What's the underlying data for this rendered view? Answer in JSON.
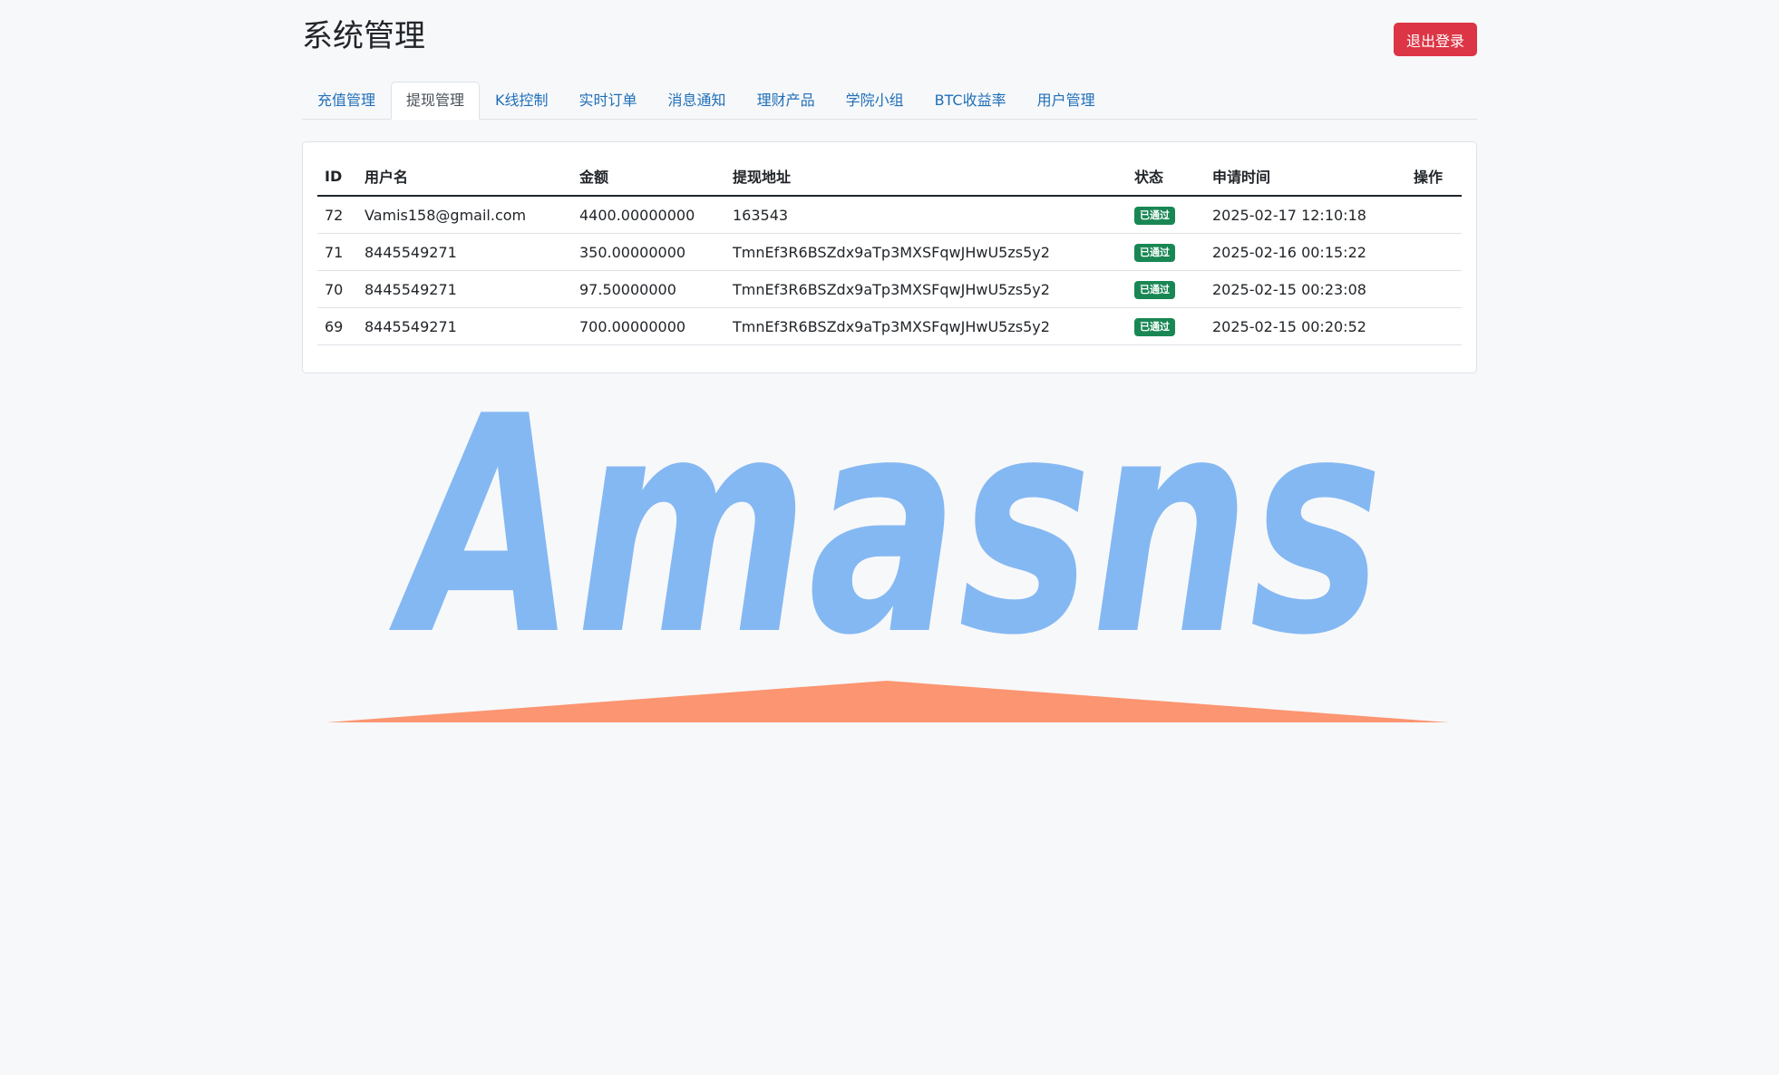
{
  "header": {
    "title": "系统管理",
    "logout_label": "退出登录"
  },
  "tabs": [
    {
      "label": "充值管理"
    },
    {
      "label": "提现管理"
    },
    {
      "label": "K线控制"
    },
    {
      "label": "实时订单"
    },
    {
      "label": "消息通知"
    },
    {
      "label": "理财产品"
    },
    {
      "label": "学院小组"
    },
    {
      "label": "BTC收益率"
    },
    {
      "label": "用户管理"
    }
  ],
  "active_tab": "提现管理",
  "table": {
    "columns": [
      "ID",
      "用户名",
      "金额",
      "提现地址",
      "状态",
      "申请时间",
      "操作"
    ],
    "rows": [
      {
        "id": "72",
        "username": "Vamis158@gmail.com",
        "amount": "4400.00000000",
        "address": "163543",
        "status": "已通过",
        "time": "2025-02-17 12:10:18",
        "action": ""
      },
      {
        "id": "71",
        "username": "8445549271",
        "amount": "350.00000000",
        "address": "TmnEf3R6BSZdx9aTp3MXSFqwJHwU5zs5y2",
        "status": "已通过",
        "time": "2025-02-16 00:15:22",
        "action": ""
      },
      {
        "id": "70",
        "username": "8445549271",
        "amount": "97.50000000",
        "address": "TmnEf3R6BSZdx9aTp3MXSFqwJHwU5zs5y2",
        "status": "已通过",
        "time": "2025-02-15 00:23:08",
        "action": ""
      },
      {
        "id": "69",
        "username": "8445549271",
        "amount": "700.00000000",
        "address": "TmnEf3R6BSZdx9aTp3MXSFqwJHwU5zs5y2",
        "status": "已通过",
        "time": "2025-02-15 00:20:52",
        "action": ""
      }
    ]
  },
  "watermark": {
    "text": "Amasns",
    "text_color": "#6aaaf0",
    "underline_color": "#fc8a62"
  },
  "colors": {
    "logout": "#dc3545",
    "badge": "#198754",
    "tab_link": "#1f6fb8"
  }
}
